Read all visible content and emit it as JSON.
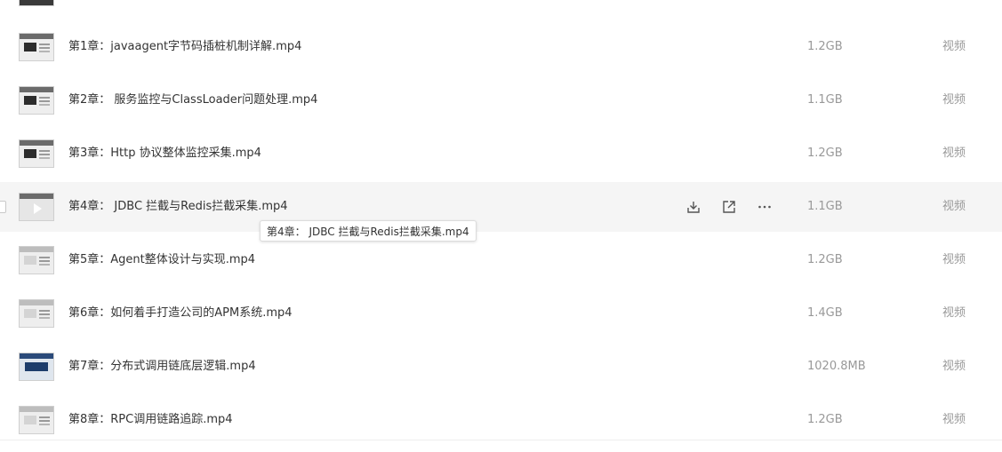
{
  "files": [
    {
      "name": "第1章：javaagent字节码插桩机制详解.mp4",
      "size": "1.2GB",
      "type": "视频"
    },
    {
      "name": "第2章： 服务监控与ClassLoader问题处理.mp4",
      "size": "1.1GB",
      "type": "视频"
    },
    {
      "name": "第3章：Http 协议整体监控采集.mp4",
      "size": "1.2GB",
      "type": "视频"
    },
    {
      "name": "第4章： JDBC 拦截与Redis拦截采集.mp4",
      "size": "1.1GB",
      "type": "视频"
    },
    {
      "name": "第5章：Agent整体设计与实现.mp4",
      "size": "1.2GB",
      "type": "视频"
    },
    {
      "name": "第6章：如何着手打造公司的APM系统.mp4",
      "size": "1.4GB",
      "type": "视频"
    },
    {
      "name": "第7章：分布式调用链底层逻辑.mp4",
      "size": "1020.8MB",
      "type": "视频"
    },
    {
      "name": "第8章：RPC调用链路追踪.mp4",
      "size": "1.2GB",
      "type": "视频"
    }
  ],
  "tooltip": "第4章： JDBC 拦截与Redis拦截采集.mp4",
  "actions": {
    "download": "download-icon",
    "share": "share-icon",
    "more": "more-icon"
  }
}
